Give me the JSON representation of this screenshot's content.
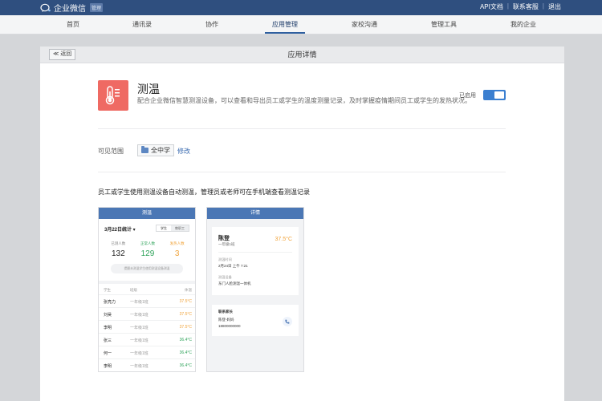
{
  "topbar": {
    "logo_text": "企业微信",
    "logo_badge": "管理",
    "links": [
      "API文档",
      "联系客服",
      "退出"
    ]
  },
  "nav": {
    "items": [
      "首页",
      "通讯录",
      "协作",
      "应用管理",
      "家校沟通",
      "管理工具",
      "我的企业"
    ],
    "active_index": 3
  },
  "panel": {
    "back_label": "≪ 返回",
    "title": "应用详情"
  },
  "app": {
    "name": "测温",
    "description": "配合企业微信智慧测温设备，可以查看和导出员工或学生的温度测量记录，及时掌握疫情期间员工或学生的发热状况。",
    "enabled_label": "已启用",
    "enabled": true
  },
  "scope": {
    "label": "可见范围",
    "chip": "全中学",
    "edit": "修改"
  },
  "feature_description": "员工或学生使用测温设备自动测温，管理员或老师可在手机端查看测温记录",
  "phone_list": {
    "bar_title": "测温",
    "date": "3月22日统计 ▾",
    "segments": [
      "学生",
      "教职工"
    ],
    "stats": [
      {
        "label": "已测人数",
        "value": "132"
      },
      {
        "label": "正常人数",
        "value": "129"
      },
      {
        "label": "发热人数",
        "value": "3"
      }
    ],
    "remind_button": "提醒未测温学生使用测温设备测温",
    "headers": [
      "学生",
      "班级",
      "体温"
    ],
    "rows": [
      {
        "name": "张亮力",
        "class": "一年级1班",
        "temp": "37.5°C",
        "status": "fever"
      },
      {
        "name": "刘昊",
        "class": "一年级1班",
        "temp": "37.5°C",
        "status": "fever"
      },
      {
        "name": "李明",
        "class": "一年级1班",
        "temp": "37.5°C",
        "status": "fever"
      },
      {
        "name": "张三",
        "class": "一年级1班",
        "temp": "36.4°C",
        "status": "normal"
      },
      {
        "name": "何一",
        "class": "一年级1班",
        "temp": "36.4°C",
        "status": "normal"
      },
      {
        "name": "李明",
        "class": "一年级1班",
        "temp": "36.4°C",
        "status": "normal"
      }
    ]
  },
  "phone_detail": {
    "bar_title": "详情",
    "name": "陈登",
    "class": "一年级1班",
    "temp": "37.5°C",
    "time_label": "测温时间",
    "time_value": "2月24日 上午 7:21",
    "device_label": "测温设备",
    "device_value": "东门人脸测温一体机",
    "contact_title": "联系家长",
    "contact_name": "陈登-妈妈",
    "contact_phone": "18800000000"
  },
  "colors": {
    "header_bg": "#2f4f7f",
    "accent": "#3b7fd0",
    "fever": "#f0a238",
    "normal": "#2ea35a",
    "app_icon": "#ef6a63"
  }
}
